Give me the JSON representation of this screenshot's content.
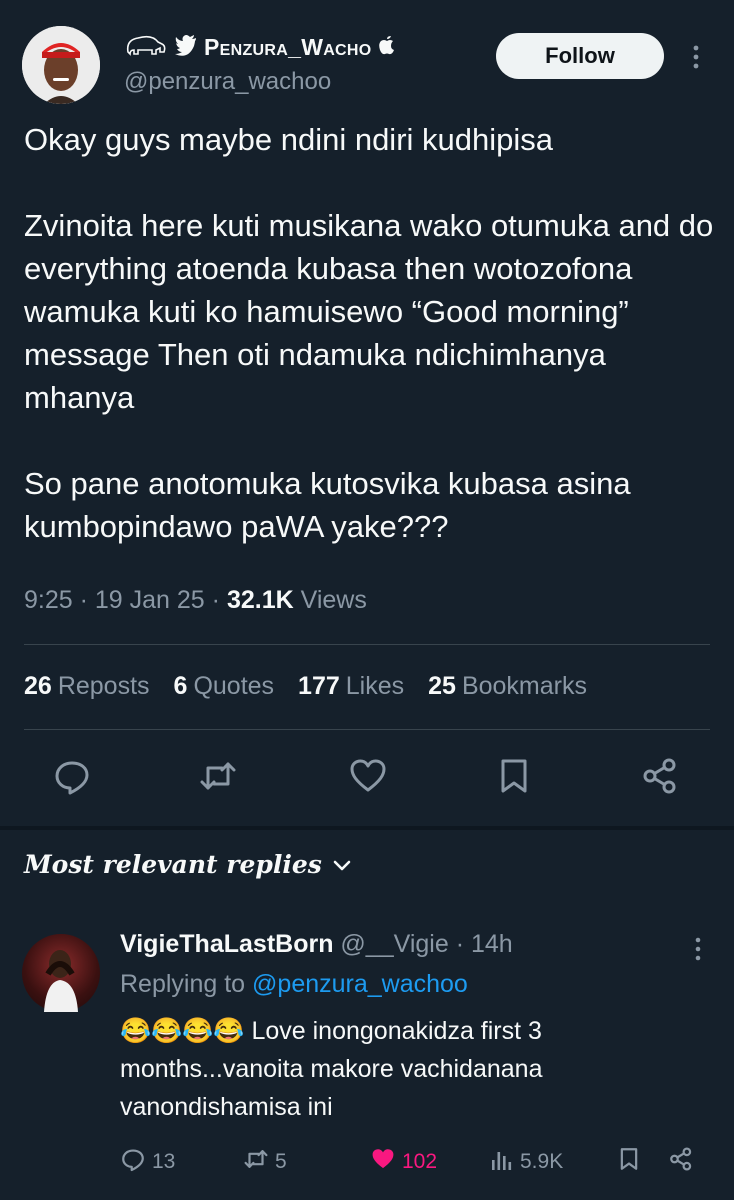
{
  "author": {
    "display_name": "Penzura_Wacho",
    "handle": "@penzura_wachoo",
    "follow_label": "Follow"
  },
  "tweet": {
    "text": "Okay guys maybe ndini ndiri kudhipisa\n\nZvinoita here kuti musikana wako otumuka and do everything atoenda kubasa then wotozofona wamuka kuti ko hamuisewo “Good morning” message Then oti ndamuka ndichimhanya mhanya\n\nSo pane anotomuka kutosvika kubasa asina kumbopindawo paWA yake???",
    "time": "9:25",
    "date": "19 Jan 25",
    "views_count": "32.1K",
    "views_label": "Views"
  },
  "stats": [
    {
      "count": "26",
      "label": "Reposts"
    },
    {
      "count": "6",
      "label": "Quotes"
    },
    {
      "count": "177",
      "label": "Likes"
    },
    {
      "count": "25",
      "label": "Bookmarks"
    }
  ],
  "actions": [
    "reply-icon",
    "repost-icon",
    "like-icon",
    "bookmark-icon",
    "share-icon"
  ],
  "replies_header": "Most relevant replies",
  "reply": {
    "name": "VigieThaLastBorn",
    "handle": "@__Vigie",
    "age": "14h",
    "replying_prefix": "Replying to",
    "replying_to": "@penzura_wachoo",
    "text": "😂😂😂😂 Love inongonakidza first 3 months...vanoita makore vachidanana vanondishamisa ini",
    "replies": "13",
    "reposts": "5",
    "likes": "102",
    "views": "5.9K"
  },
  "colors": {
    "background": "#15202b",
    "accent": "#1d9bf0",
    "like_pink": "#f91880",
    "muted": "#8b98a5"
  }
}
